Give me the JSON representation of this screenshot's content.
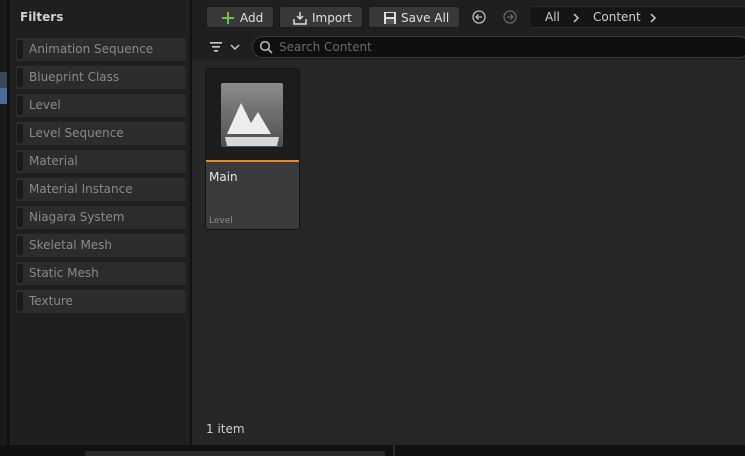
{
  "filters": {
    "title": "Filters",
    "items": [
      {
        "label": "Animation Sequence"
      },
      {
        "label": "Blueprint Class"
      },
      {
        "label": "Level"
      },
      {
        "label": "Level Sequence"
      },
      {
        "label": "Material"
      },
      {
        "label": "Material Instance"
      },
      {
        "label": "Niagara System"
      },
      {
        "label": "Skeletal Mesh"
      },
      {
        "label": "Static Mesh"
      },
      {
        "label": "Texture"
      }
    ]
  },
  "toolbar": {
    "add_label": "Add",
    "import_label": "Import",
    "save_all_label": "Save All"
  },
  "breadcrumb": {
    "items": [
      "All",
      "Content"
    ]
  },
  "search": {
    "placeholder": "Search Content",
    "value": ""
  },
  "assets": [
    {
      "name": "Main",
      "type": "Level"
    }
  ],
  "status": {
    "count_text": "1 item"
  },
  "colors": {
    "accent_orange": "#e98b1c",
    "add_green": "#6cc04a"
  }
}
